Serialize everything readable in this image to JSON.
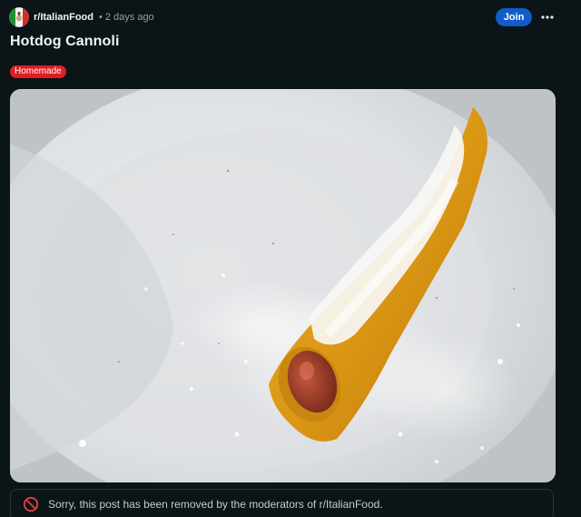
{
  "post": {
    "subreddit": "r/ItalianFood",
    "separator": "•",
    "timestamp": "2 days ago",
    "title": "Hotdog Cannoli",
    "flair": "Homemade",
    "join_label": "Join",
    "removed_notice": "Sorry, this post has been removed by the moderators of r/ItalianFood."
  },
  "icons": {
    "avatar": "italian-flag-avatar",
    "more": "ellipsis-horizontal-icon",
    "removed": "prohibited-icon"
  },
  "colors": {
    "background": "#0b1416",
    "join_button": "#115bca",
    "flair": "#e21c21",
    "removed_icon": "#e0443e"
  }
}
